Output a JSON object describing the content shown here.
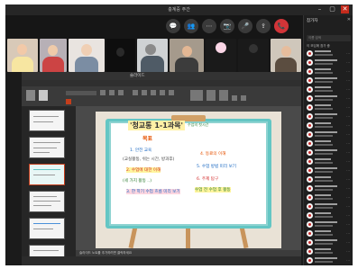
{
  "window": {
    "title": "충계중 주간",
    "controls": {
      "minimize": "–",
      "maximize": "▢",
      "close": "✕"
    }
  },
  "colors": {
    "slide_bg": "#e9e2d6",
    "board_frame": "#64c6c4",
    "easel": "#c8945c",
    "accent_red": "#d13438"
  },
  "meeting_controls": [
    {
      "icon": "chat-icon",
      "glyph": "💬"
    },
    {
      "icon": "people-icon",
      "glyph": "👥"
    },
    {
      "icon": "more-icon",
      "glyph": "⋯"
    },
    {
      "icon": "camera-icon",
      "glyph": "📷"
    },
    {
      "icon": "mic-icon",
      "glyph": "🎤"
    },
    {
      "icon": "share-icon",
      "glyph": "⇪"
    },
    {
      "icon": "leave-icon",
      "glyph": "📞"
    }
  ],
  "presentation": {
    "file_title": "슬라이드",
    "notes_hint": "슬라이드 노트를 추가하려면 클릭하세요"
  },
  "slide": {
    "title": "'청교통 1-1과목'",
    "subtitle": "수업의 첫시간",
    "label": "목표",
    "left_lines": [
      "1. 안전 교육",
      "(교실활동, 쉬는 시간, 방과후)",
      "2. 수업에 대한 이해",
      "(세 가지 활동 ..)",
      "3. 한 학기 수업 흐름 미리 보기"
    ],
    "right_lines": [
      "4. 동료의 이해",
      "5. 수업 방법 미리 보기",
      "6. 주제 탐구",
      "수업 전 수업 후 활동"
    ]
  },
  "panel": {
    "title": "참가자",
    "search_placeholder": "이름 검색",
    "section": "이 모임에 참가 중"
  }
}
